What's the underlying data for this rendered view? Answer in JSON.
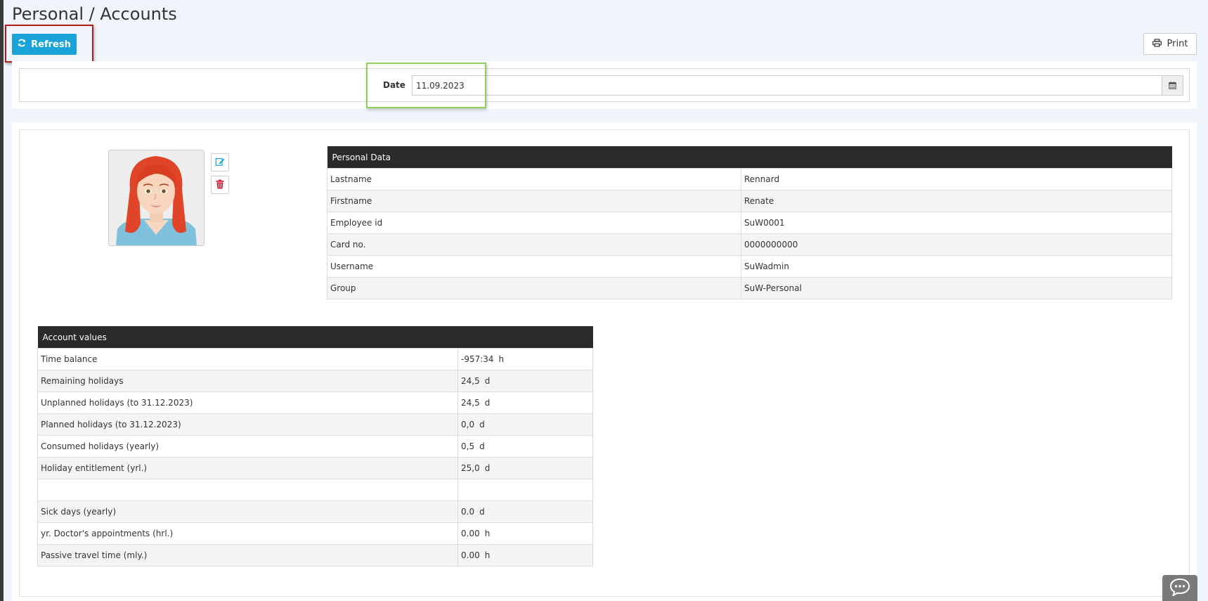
{
  "header": {
    "title": "Personal / Accounts",
    "refresh_label": "Refresh",
    "print_label": "Print"
  },
  "filter": {
    "date_label": "Date",
    "date_value": "11.09.2023"
  },
  "personal_data": {
    "title": "Personal Data",
    "rows": [
      {
        "label": "Lastname",
        "value": "Rennard"
      },
      {
        "label": "Firstname",
        "value": "Renate"
      },
      {
        "label": "Employee id",
        "value": "SuW0001"
      },
      {
        "label": "Card no.",
        "value": "0000000000"
      },
      {
        "label": "Username",
        "value": "SuWadmin"
      },
      {
        "label": "Group",
        "value": "SuW-Personal"
      }
    ]
  },
  "account_values": {
    "title": "Account values",
    "rows": [
      {
        "label": "Time balance",
        "value": "-957:34",
        "unit": "h"
      },
      {
        "label": "Remaining holidays",
        "value": "24,5",
        "unit": "d"
      },
      {
        "label": "Unplanned holidays (to 31.12.2023)",
        "value": "24,5",
        "unit": "d"
      },
      {
        "label": "Planned holidays (to 31.12.2023)",
        "value": "0,0",
        "unit": "d"
      },
      {
        "label": "Consumed holidays (yearly)",
        "value": "0,5",
        "unit": "d"
      },
      {
        "label": "Holiday entitlement (yrl.)",
        "value": "25,0",
        "unit": "d"
      },
      {
        "label": "",
        "value": "",
        "unit": ""
      },
      {
        "label": "Sick days (yearly)",
        "value": "0.0",
        "unit": "d"
      },
      {
        "label": "yr. Doctor's appointments (hrl.)",
        "value": "0.00",
        "unit": "h"
      },
      {
        "label": "Passive travel time (mly.)",
        "value": "0.00",
        "unit": "h"
      }
    ]
  },
  "colors": {
    "accent": "#1aa3d9",
    "table_header": "#2a2a2a",
    "highlight_red": "#b01c1c",
    "highlight_green": "#8dd15a",
    "delete_icon": "#d9243d"
  },
  "icons": {
    "refresh": "refresh-icon",
    "print": "printer-icon",
    "calendar": "calendar-icon",
    "edit": "edit-icon",
    "delete": "trash-icon",
    "chat": "chat-icon"
  }
}
